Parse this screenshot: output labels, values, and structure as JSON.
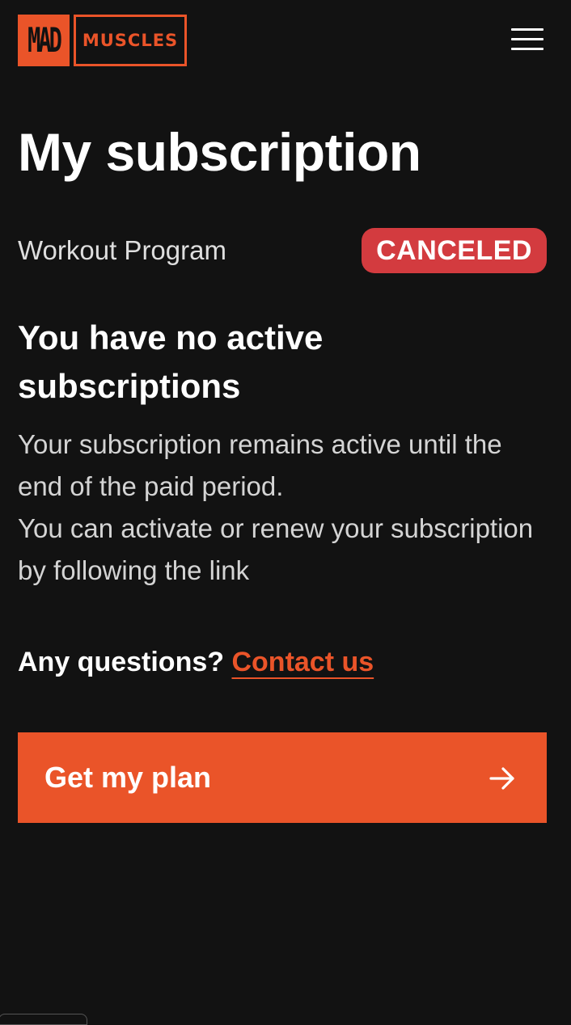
{
  "header": {
    "logo": {
      "part1": "MAD",
      "part2": "MUSCLES"
    },
    "menu_icon": "hamburger-menu-icon"
  },
  "page": {
    "title": "My subscription"
  },
  "subscription": {
    "plan_name": "Workout Program",
    "status": "CANCELED",
    "heading": "You have no active subscriptions",
    "description_line1": "Your subscription remains active until the end of the paid period.",
    "description_line2": "You can activate or renew your subscription by following the link"
  },
  "support": {
    "question": "Any questions?",
    "link_label": "Contact us"
  },
  "cta": {
    "label": "Get my plan",
    "icon": "arrow-right-icon"
  },
  "colors": {
    "background": "#121212",
    "accent": "#ea5429",
    "status_canceled": "#d33b3f"
  }
}
